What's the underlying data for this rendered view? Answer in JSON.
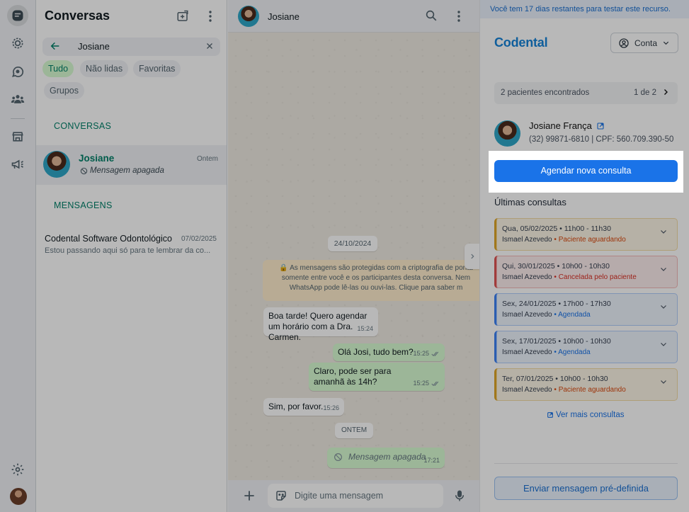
{
  "rail": {
    "icons": [
      "chats-icon",
      "status-icon",
      "channels-icon",
      "communities-icon",
      "store-icon",
      "megaphone-icon",
      "settings-icon"
    ]
  },
  "list": {
    "title": "Conversas",
    "search_value": "Josiane",
    "filters": [
      "Tudo",
      "Não lidas",
      "Favoritas",
      "Grupos"
    ],
    "section_conversas": "CONVERSAS",
    "section_mensagens": "MENSAGENS",
    "conversation": {
      "name": "Josiane",
      "time": "Ontem",
      "preview": "Mensagem apagada"
    },
    "message": {
      "name": "Codental Software Odontológico",
      "date": "07/02/2025",
      "preview": "Estou passando aqui só para te lembrar da co..."
    }
  },
  "chat": {
    "contact": "Josiane",
    "date_1": "24/10/2024",
    "encryption_line_1": "🔒 As mensagens são protegidas com a criptografia de ponta",
    "encryption_line_2": "somente entre você e os participantes desta conversa. Nem",
    "encryption_line_3": "WhatsApp pode lê-las ou ouvi-las. Clique para saber m",
    "messages": [
      {
        "dir": "in",
        "text": "Boa tarde! Quero agendar um horário com a Dra. Carmen.",
        "time": "15:24"
      },
      {
        "dir": "out",
        "text": "Olá Josi, tudo bem?",
        "time": "15:25"
      },
      {
        "dir": "out",
        "text": "Claro, pode ser para amanhã às 14h?",
        "time": "15:25"
      },
      {
        "dir": "in",
        "text": "Sim, por favor.",
        "time": "15:26"
      },
      {
        "dir": "out",
        "text": "Mensagem apagada",
        "time": "17:21"
      }
    ],
    "date_2": "ONTEM",
    "composer_placeholder": "Digite uma mensagem"
  },
  "panel": {
    "trial": "Você tem 17 dias restantes para testar este recurso.",
    "brand": "Codental",
    "account": "Conta",
    "found": "2 pacientes encontrados",
    "pager": "1 de 2",
    "patient_name": "Josiane França",
    "patient_info": "(32) 99871-6810  |  CPF: 560.709.390-50",
    "cta": "Agendar nova consulta",
    "last_title": "Últimas consultas",
    "appointments": [
      {
        "date": "Qua, 05/02/2025 • 11h00 - 11h30",
        "doctor": "Ismael Azevedo",
        "status": "Paciente aguardando",
        "color": "#e0a526",
        "bg": "#fdf6e6",
        "status_color": "#d9480f"
      },
      {
        "date": "Qui, 30/01/2025 • 10h00 - 10h30",
        "doctor": "Ismael Azevedo",
        "status": "Cancelada pelo paciente",
        "color": "#e05252",
        "bg": "#fdeeee",
        "status_color": "#d93025"
      },
      {
        "date": "Sex, 24/01/2025 • 17h00 - 17h30",
        "doctor": "Ismael Azevedo",
        "status": "Agendada",
        "color": "#3b82f6",
        "bg": "#eef4fd",
        "status_color": "#1a73e8"
      },
      {
        "date": "Sex, 17/01/2025 • 10h00 - 10h30",
        "doctor": "Ismael Azevedo",
        "status": "Agendada",
        "color": "#3b82f6",
        "bg": "#eef4fd",
        "status_color": "#1a73e8"
      },
      {
        "date": "Ter, 07/01/2025 • 10h00 - 10h30",
        "doctor": "Ismael Azevedo",
        "status": "Paciente aguardando",
        "color": "#e0a526",
        "bg": "#fdf6e6",
        "status_color": "#d9480f"
      }
    ],
    "more": "Ver mais consultas",
    "send": "Enviar mensagem pré-definida"
  },
  "colors": {
    "whatsapp_green": "#008069",
    "codental_blue": "#1683d8",
    "primary_button": "#1a73e8"
  }
}
